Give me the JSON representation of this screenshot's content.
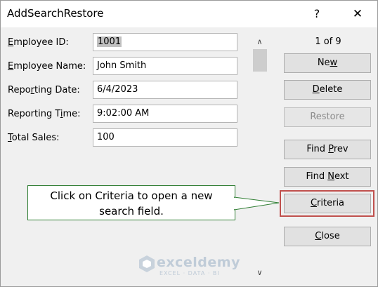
{
  "window": {
    "title": "AddSearchRestore",
    "help_label": "?",
    "close_label": "✕"
  },
  "form": {
    "fields": [
      {
        "label_pre": "",
        "label_key": "E",
        "label_post": "mployee ID:",
        "value": "1001"
      },
      {
        "label_pre": "",
        "label_key": "E",
        "label_post": "mployee Name:",
        "value": "John Smith"
      },
      {
        "label_pre": "Repo",
        "label_key": "r",
        "label_post": "ting Date:",
        "value": "6/4/2023"
      },
      {
        "label_pre": "Reporting T",
        "label_key": "i",
        "label_post": "me:",
        "value": "9:02:00 AM"
      },
      {
        "label_pre": "",
        "label_key": "T",
        "label_post": "otal Sales:",
        "value": "100"
      }
    ]
  },
  "scrollbar": {
    "up_glyph": "∧",
    "down_glyph": "∨"
  },
  "record": {
    "counter": "1 of 9"
  },
  "buttons": {
    "new": {
      "pre": "Ne",
      "key": "w",
      "post": ""
    },
    "delete": {
      "pre": "",
      "key": "D",
      "post": "elete"
    },
    "restore": {
      "pre": "",
      "key": "R",
      "post": "estore",
      "disabled": true
    },
    "find_prev": {
      "pre": "Find ",
      "key": "P",
      "post": "rev"
    },
    "find_next": {
      "pre": "Find ",
      "key": "N",
      "post": "ext"
    },
    "criteria": {
      "pre": "",
      "key": "C",
      "post": "riteria"
    },
    "close": {
      "pre": "",
      "key": "C",
      "post": "lose"
    }
  },
  "callout": {
    "line1": "Click on Criteria to open a new",
    "line2": "search field."
  },
  "watermark": {
    "name": "exceldemy",
    "tagline": "EXCEL · DATA · BI"
  },
  "colors": {
    "highlight_border": "#c0504d",
    "callout_border": "#2e7d32",
    "button_face": "#e1e1e1",
    "dialog_bg": "#f0f0f0"
  }
}
